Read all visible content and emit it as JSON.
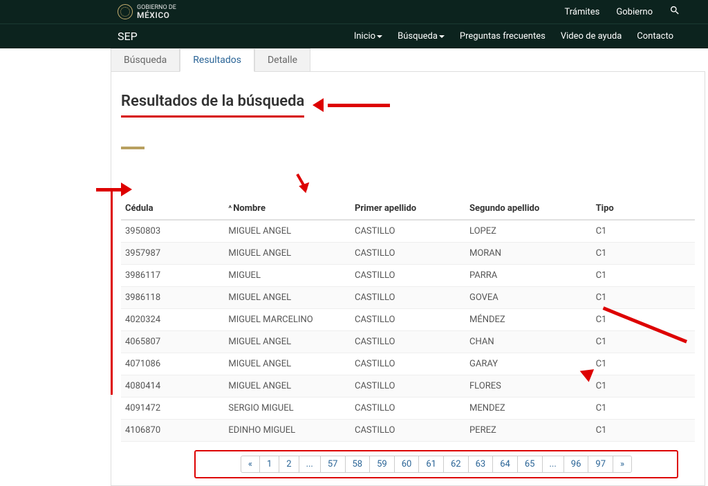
{
  "gob": {
    "small": "GOBIERNO DE",
    "big": "MÉXICO"
  },
  "topbar": {
    "tramites": "Trámites",
    "gobierno": "Gobierno"
  },
  "navbar": {
    "brand": "SEP",
    "links": {
      "inicio": "Inicio",
      "busqueda": "Búsqueda",
      "faq": "Preguntas frecuentes",
      "video": "Video de ayuda",
      "contacto": "Contacto"
    }
  },
  "tabs": {
    "busqueda": "Búsqueda",
    "resultados": "Resultados",
    "detalle": "Detalle"
  },
  "title": "Resultados de la búsqueda",
  "columns": {
    "cedula": "Cédula",
    "nombre": "Nombre",
    "primer": "Primer apellido",
    "segundo": "Segundo apellido",
    "tipo": "Tipo"
  },
  "rows": [
    {
      "cedula": "3950803",
      "nombre": "MIGUEL ANGEL",
      "primer": "CASTILLO",
      "segundo": "LOPEZ",
      "tipo": "C1"
    },
    {
      "cedula": "3957987",
      "nombre": "MIGUEL ANGEL",
      "primer": "CASTILLO",
      "segundo": "MORAN",
      "tipo": "C1"
    },
    {
      "cedula": "3986117",
      "nombre": "MIGUEL",
      "primer": "CASTILLO",
      "segundo": "PARRA",
      "tipo": "C1"
    },
    {
      "cedula": "3986118",
      "nombre": "MIGUEL ANGEL",
      "primer": "CASTILLO",
      "segundo": "GOVEA",
      "tipo": "C1"
    },
    {
      "cedula": "4020324",
      "nombre": "MIGUEL MARCELINO",
      "primer": "CASTILLO",
      "segundo": "MÉNDEZ",
      "tipo": "C1"
    },
    {
      "cedula": "4065807",
      "nombre": "MIGUEL ANGEL",
      "primer": "CASTILLO",
      "segundo": "CHAN",
      "tipo": "C1"
    },
    {
      "cedula": "4071086",
      "nombre": "MIGUEL ANGEL",
      "primer": "CASTILLO",
      "segundo": "GARAY",
      "tipo": "C1"
    },
    {
      "cedula": "4080414",
      "nombre": "MIGUEL ANGEL",
      "primer": "CASTILLO",
      "segundo": "FLORES",
      "tipo": "C1"
    },
    {
      "cedula": "4091472",
      "nombre": "SERGIO MIGUEL",
      "primer": "CASTILLO",
      "segundo": "MENDEZ",
      "tipo": "C1"
    },
    {
      "cedula": "4106870",
      "nombre": "EDINHO MIGUEL",
      "primer": "CASTILLO",
      "segundo": "PEREZ",
      "tipo": "C1"
    }
  ],
  "pagination": [
    "«",
    "1",
    "2",
    "...",
    "57",
    "58",
    "59",
    "60",
    "61",
    "62",
    "63",
    "64",
    "65",
    "...",
    "96",
    "97",
    "»"
  ]
}
